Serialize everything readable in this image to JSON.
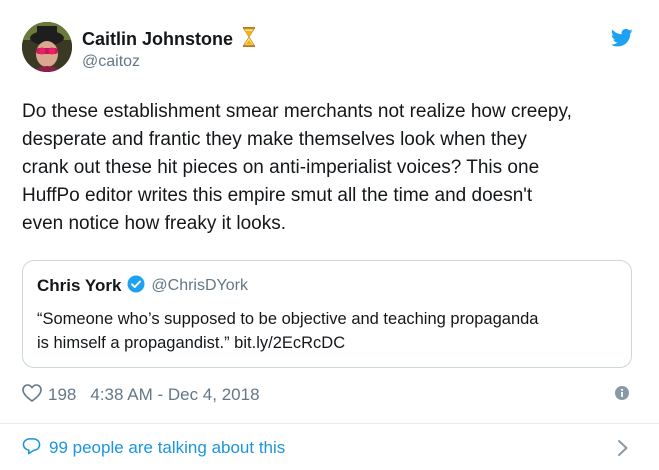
{
  "author": {
    "display_name": "Caitlin Johnstone",
    "handle": "@caitoz"
  },
  "tweet": {
    "text": "Do these establishment smear merchants not realize how creepy,\ndesperate and frantic they make themselves look when they\ncrank out these hit pieces on anti-imperialist voices? This one\nHuffPo editor writes this empire smut all the time and doesn't\neven notice how freaky it looks."
  },
  "quoted_tweet": {
    "display_name": "Chris York",
    "handle": "@ChrisDYork",
    "text": "“Someone who’s supposed to be objective and teaching propaganda\nis himself a propagandist.” bit.ly/2EcRcDC"
  },
  "meta": {
    "likes": "198",
    "timestamp": "4:38 AM - Dec 4, 2018"
  },
  "footer": {
    "talking": "99 people are talking about this"
  },
  "colors": {
    "twitter_blue": "#1da1f2",
    "link_blue": "#1b95e0",
    "muted": "#657786",
    "verified": "#1da1f2",
    "hourglass": "#f4b400"
  },
  "icons": [
    "hourglass-icon",
    "twitter-bird-icon",
    "verified-badge-icon",
    "heart-icon",
    "info-icon",
    "comment-bubble-icon",
    "chevron-right-icon"
  ]
}
